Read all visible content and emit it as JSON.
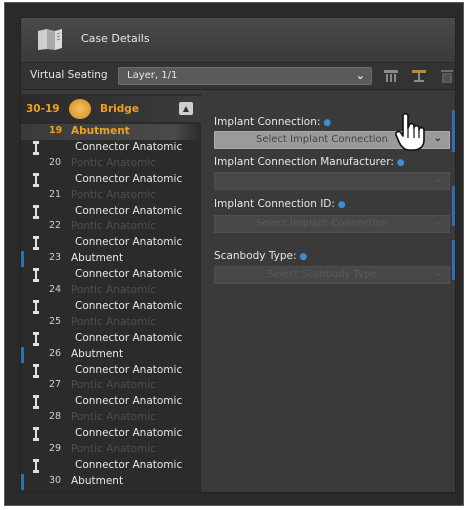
{
  "header": {
    "title": "Case Details",
    "icon": "case-document-icon"
  },
  "toolbar": {
    "label": "Virtual Seating",
    "selected": "Layer, 1/1",
    "icons": [
      "articulator-icon",
      "articulator-alt-icon",
      "trash-icon"
    ]
  },
  "bridge": {
    "range": "30-19",
    "label": "Bridge",
    "icon": "bridge-icon",
    "collapse": "▲"
  },
  "tree": [
    {
      "num": "19",
      "name": "Abutment",
      "kind": "abutment",
      "selected": true
    },
    {
      "num": "",
      "name": "Connector Anatomic",
      "kind": "connector"
    },
    {
      "num": "20",
      "name": "Pontic Anatomic",
      "kind": "pontic"
    },
    {
      "num": "",
      "name": "Connector Anatomic",
      "kind": "connector"
    },
    {
      "num": "21",
      "name": "Pontic Anatomic",
      "kind": "pontic"
    },
    {
      "num": "",
      "name": "Connector Anatomic",
      "kind": "connector"
    },
    {
      "num": "22",
      "name": "Pontic Anatomic",
      "kind": "pontic"
    },
    {
      "num": "",
      "name": "Connector Anatomic",
      "kind": "connector"
    },
    {
      "num": "23",
      "name": "Abutment",
      "kind": "abutment"
    },
    {
      "num": "",
      "name": "Connector Anatomic",
      "kind": "connector"
    },
    {
      "num": "24",
      "name": "Pontic Anatomic",
      "kind": "pontic"
    },
    {
      "num": "",
      "name": "Connector Anatomic",
      "kind": "connector"
    },
    {
      "num": "25",
      "name": "Pontic Anatomic",
      "kind": "pontic"
    },
    {
      "num": "",
      "name": "Connector Anatomic",
      "kind": "connector"
    },
    {
      "num": "26",
      "name": "Abutment",
      "kind": "abutment"
    },
    {
      "num": "",
      "name": "Connector Anatomic",
      "kind": "connector"
    },
    {
      "num": "27",
      "name": "Pontic Anatomic",
      "kind": "pontic"
    },
    {
      "num": "",
      "name": "Connector Anatomic",
      "kind": "connector"
    },
    {
      "num": "28",
      "name": "Pontic Anatomic",
      "kind": "pontic"
    },
    {
      "num": "",
      "name": "Connector Anatomic",
      "kind": "connector"
    },
    {
      "num": "29",
      "name": "Pontic Anatomic",
      "kind": "pontic"
    },
    {
      "num": "",
      "name": "Connector Anatomic",
      "kind": "connector"
    },
    {
      "num": "30",
      "name": "Abutment",
      "kind": "abutment"
    }
  ],
  "fields": {
    "implant_connection": {
      "label": "Implant Connection:",
      "placeholder": "Select Implant Connection"
    },
    "manufacturer": {
      "label": "Implant Connection Manufacturer:",
      "placeholder": ""
    },
    "connection_id": {
      "label": "Implant Connection ID:",
      "placeholder": "Select Implant Connection"
    },
    "scanbody": {
      "label": "Scanbody Type:",
      "placeholder": "Select Scanbody Type"
    }
  },
  "colors": {
    "accent": "#f0a020",
    "marker": "#2f6fb0",
    "required": "#3a8fd8"
  }
}
